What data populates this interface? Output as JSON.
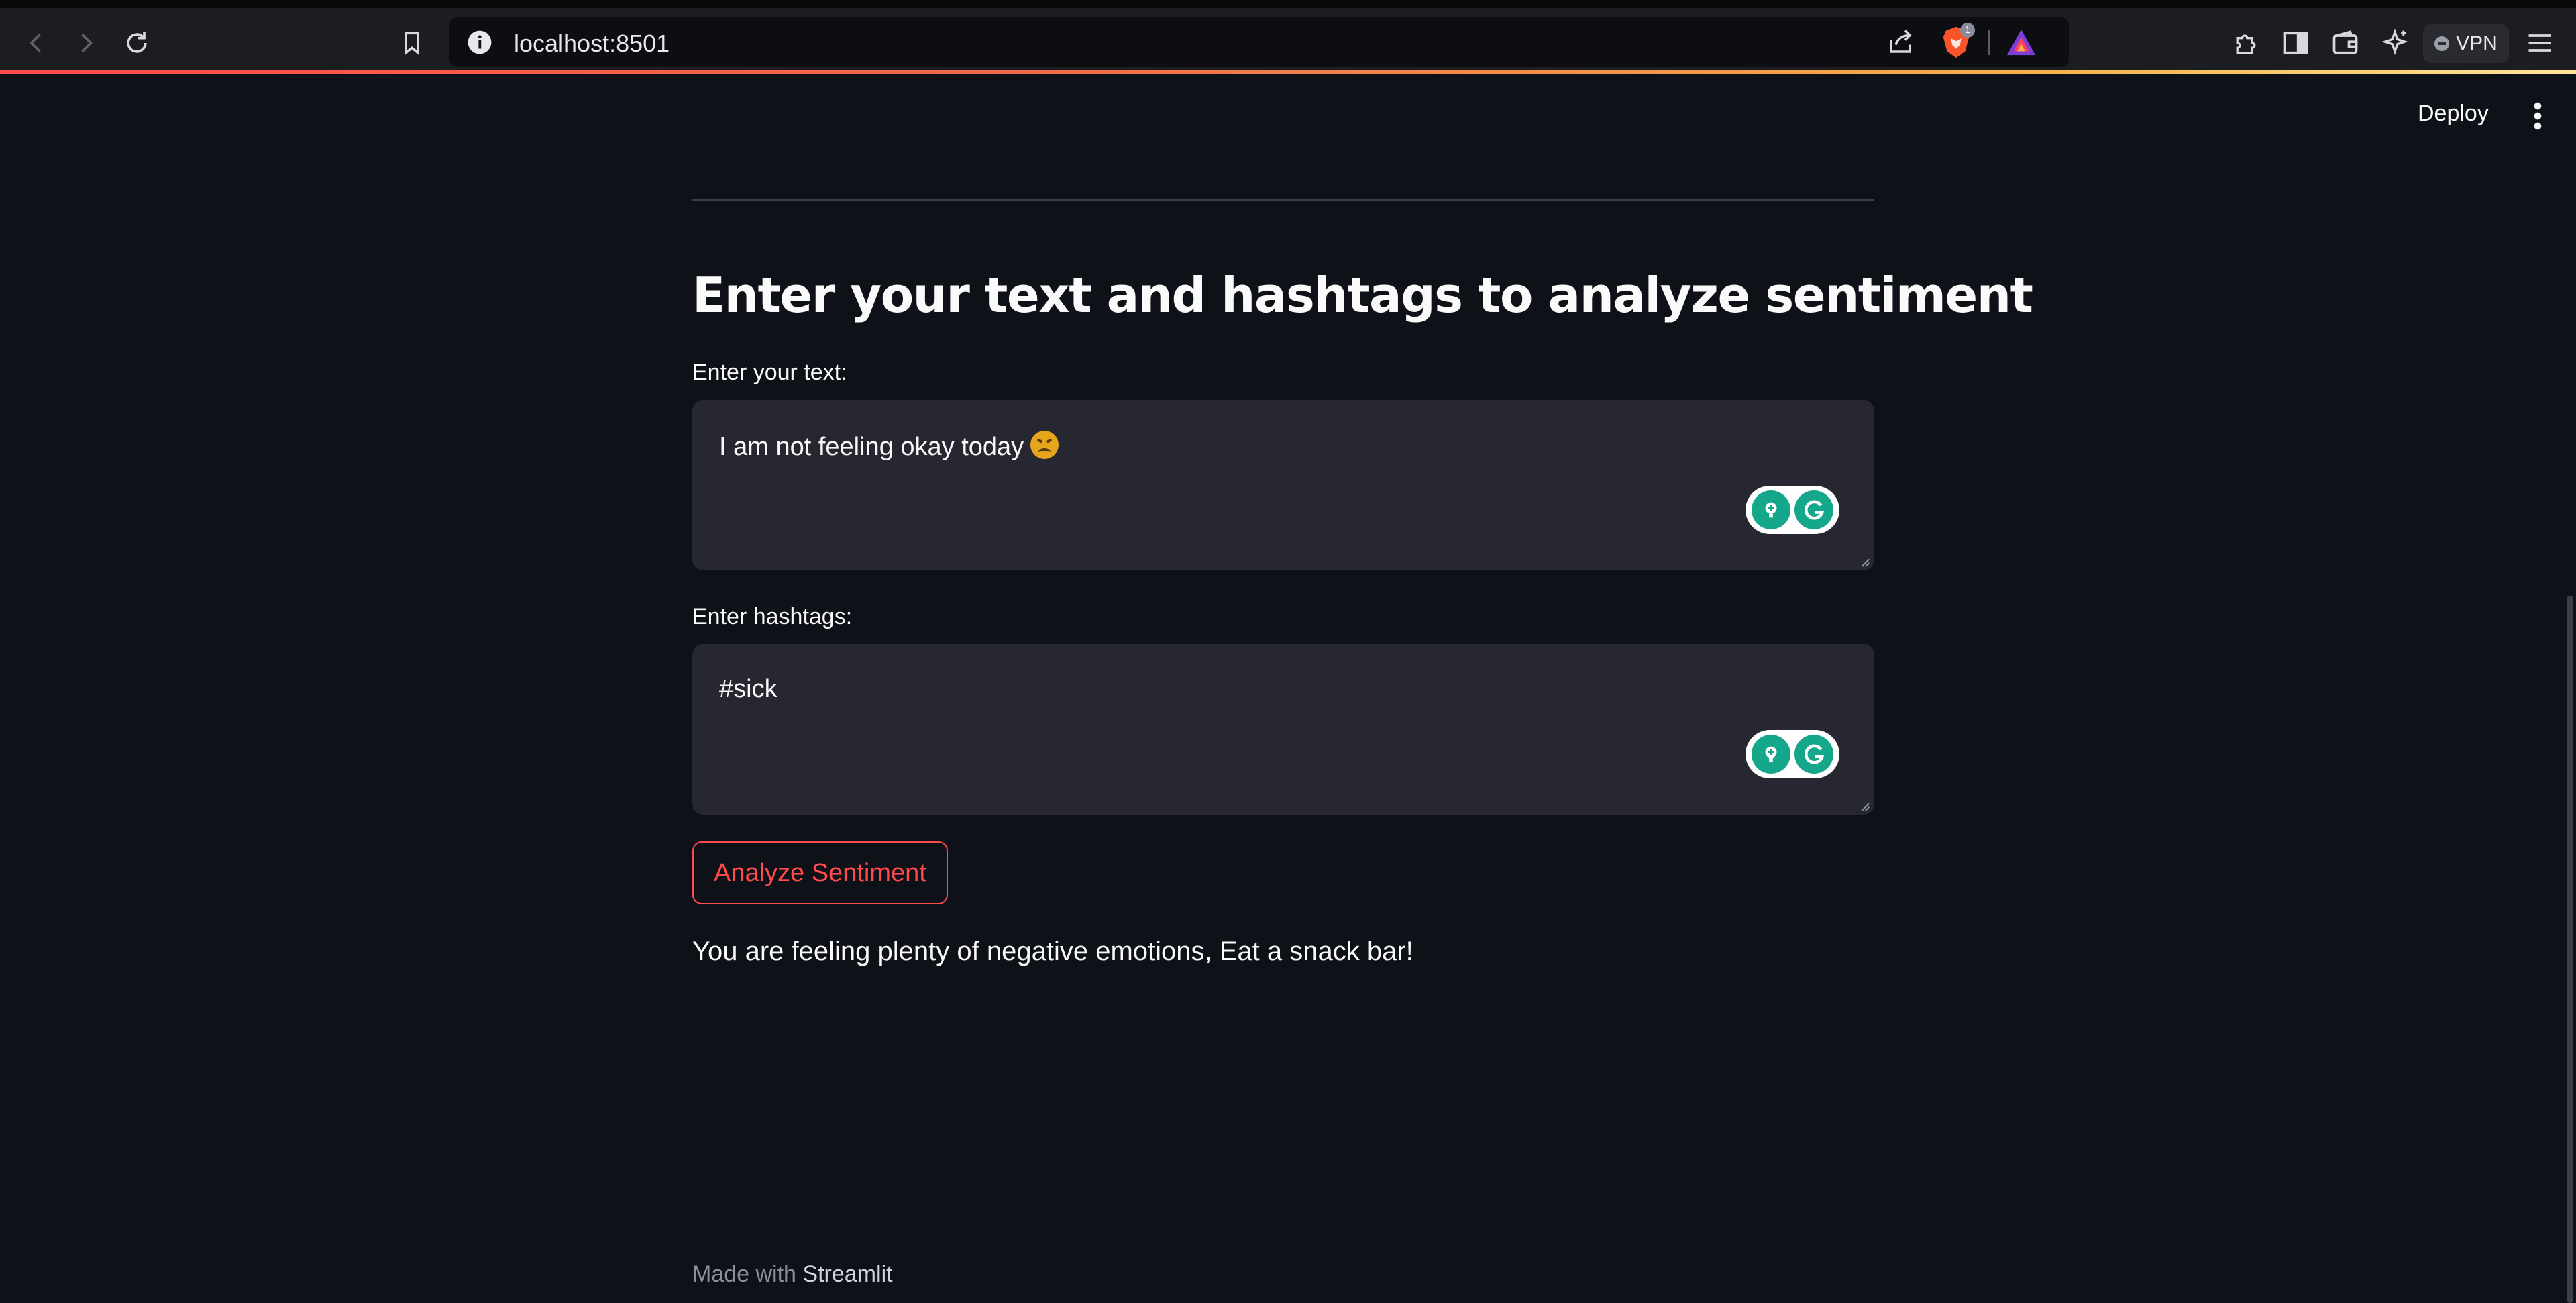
{
  "browser": {
    "url": "localhost:8501",
    "rewards_badge": "1",
    "vpn_label": "VPN"
  },
  "app": {
    "deploy_label": "Deploy",
    "title": "Enter your text and hashtags to analyze sentiment",
    "text_field": {
      "label": "Enter your text:",
      "value": "I am not feeling okay today"
    },
    "hashtag_field": {
      "label": "Enter hashtags:",
      "value": "#sick"
    },
    "analyze_button": "Analyze Sentiment",
    "result": "You are feeling plenty of negative emotions, Eat a snack bar!",
    "footer": {
      "prefix": "Made with",
      "brand": "Streamlit"
    }
  },
  "colors": {
    "background": "#0e1117",
    "input_bg": "#262730",
    "accent": "#ff4b4b",
    "grammarly": "#15a78a"
  },
  "icons": {
    "emoji": "tired-face-emoji",
    "grammarly": "grammarly-icon"
  }
}
